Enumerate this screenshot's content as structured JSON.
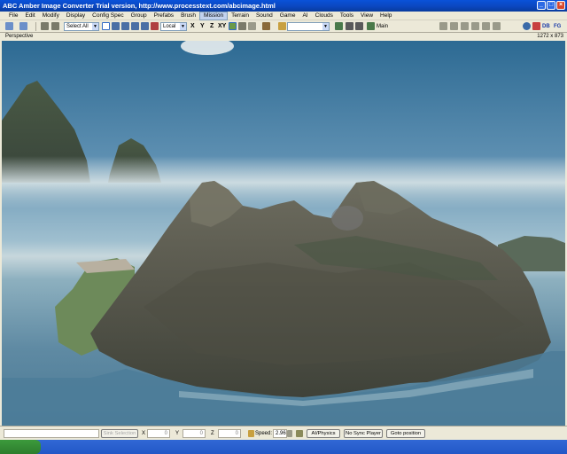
{
  "window": {
    "title": "ABC Amber Image Converter Trial version, http://www.processtext.com/abcimage.html"
  },
  "menu": {
    "items": [
      "File",
      "Edit",
      "Modify",
      "Display",
      "Config Spec",
      "Group",
      "Prefabs",
      "Brush",
      "Mission",
      "Terrain",
      "Sound",
      "Game",
      "AI",
      "Clouds",
      "Tools",
      "View",
      "Help"
    ],
    "active": "Mission"
  },
  "toolbar": {
    "selection_combo": "Select All",
    "coord_combo": "Local",
    "axes": [
      "X",
      "Y",
      "Z",
      "XY"
    ],
    "layer_label": "Main",
    "right_labels": [
      "DB",
      "FG"
    ]
  },
  "viewport": {
    "mode_label": "Perspective",
    "resolution": "1272 x 873"
  },
  "statusbar": {
    "sink_selection": "Sink Selection",
    "x_label": "X",
    "x_value": "0",
    "y_label": "Y",
    "y_value": "0",
    "z_label": "Z",
    "z_value": "0",
    "speed_label": "Speed:",
    "speed_value": "2.96",
    "buttons": [
      "AI/Physics",
      "No Sync Player",
      "Goto position"
    ]
  },
  "colors": {
    "titlebar": "#0b46bd",
    "chrome": "#ece9d8",
    "sky": "#2d6a93",
    "fog": "#c7d7dc",
    "water": "#4b7a95",
    "rock": "#5b5a4e"
  }
}
